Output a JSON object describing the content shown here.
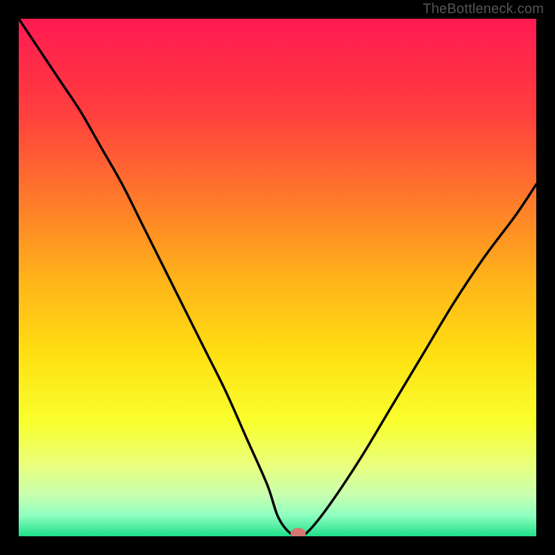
{
  "attribution": "TheBottleneck.com",
  "chart_data": {
    "type": "line",
    "title": "",
    "xlabel": "",
    "ylabel": "",
    "xlim": [
      0,
      100
    ],
    "ylim": [
      0,
      100
    ],
    "grid": false,
    "legend": false,
    "background_gradient": {
      "stops": [
        {
          "offset": 0.0,
          "color": "#ff1a52"
        },
        {
          "offset": 0.18,
          "color": "#ff3e3e"
        },
        {
          "offset": 0.35,
          "color": "#ff7a2b"
        },
        {
          "offset": 0.5,
          "color": "#ffb21a"
        },
        {
          "offset": 0.65,
          "color": "#ffe012"
        },
        {
          "offset": 0.78,
          "color": "#f9ff2e"
        },
        {
          "offset": 0.86,
          "color": "#eaff7a"
        },
        {
          "offset": 0.92,
          "color": "#c9ffb0"
        },
        {
          "offset": 0.96,
          "color": "#8effc0"
        },
        {
          "offset": 1.0,
          "color": "#1fe08a"
        }
      ]
    },
    "series": [
      {
        "name": "bottleneck-curve",
        "x": [
          0,
          4,
          8,
          12,
          16,
          20,
          24,
          28,
          32,
          36,
          40,
          44,
          48,
          50,
          52,
          54,
          56,
          60,
          66,
          72,
          78,
          84,
          90,
          96,
          100
        ],
        "y": [
          100,
          94,
          88,
          82,
          75,
          68,
          60,
          52,
          44,
          36,
          28,
          19,
          10,
          4,
          1,
          0,
          1,
          6,
          15,
          25,
          35,
          45,
          54,
          62,
          68
        ]
      }
    ],
    "marker": {
      "name": "optimal-point",
      "x": 54,
      "y": 0,
      "color": "#d6776f"
    }
  }
}
